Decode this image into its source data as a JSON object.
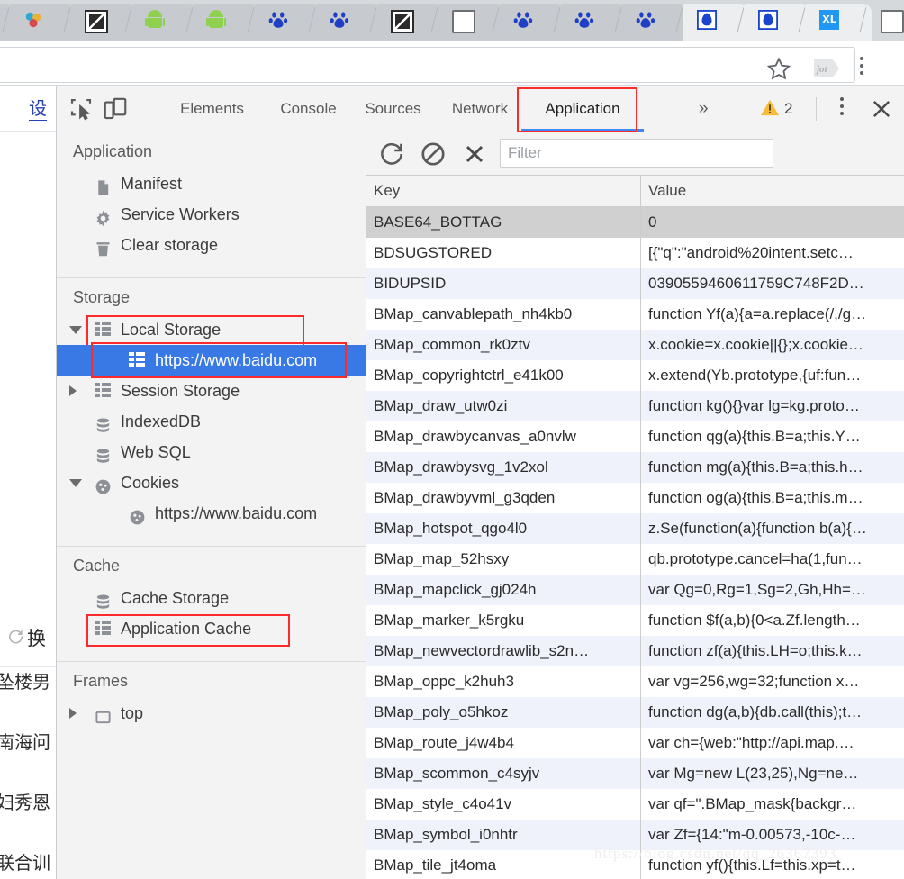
{
  "browser": {
    "tabs": [
      {
        "icon": "colored-site-icon"
      },
      {
        "icon": "colored-site-icon"
      },
      {
        "icon": "document-bw-icon"
      },
      {
        "icon": "android-icon"
      },
      {
        "icon": "android-icon"
      },
      {
        "icon": "baidu-paw-icon"
      },
      {
        "icon": "baidu-paw-icon"
      },
      {
        "icon": "document-bw-icon"
      },
      {
        "icon": "blank-page-icon"
      },
      {
        "icon": "baidu-paw-icon"
      },
      {
        "icon": "baidu-paw-icon"
      },
      {
        "icon": "baidu-paw-icon"
      },
      {
        "icon": "blue-app-icon"
      },
      {
        "icon": "blue-app-icon"
      },
      {
        "icon": "xunlei-icon"
      },
      {
        "icon": "blank-page-icon"
      }
    ],
    "tab_overflow_chevron": "^",
    "omnibox_value": "",
    "bookmark_icon": "star-icon",
    "extension_label": "jot",
    "menu_icon": "kebab-menu-icon"
  },
  "page_behind": {
    "top_link": "设",
    "refresh_label": "换",
    "items": [
      "坠楼男",
      "南海问",
      "妇秀恩",
      "联合训"
    ]
  },
  "devtools": {
    "inspect_icon": "inspect-element-icon",
    "device_icon": "device-toolbar-icon",
    "tabs": [
      {
        "label": "Elements",
        "selected": false
      },
      {
        "label": "Console",
        "selected": false
      },
      {
        "label": "Sources",
        "selected": false
      },
      {
        "label": "Network",
        "selected": false
      },
      {
        "label": "Application",
        "selected": true
      }
    ],
    "more_tabs_icon": "double-chevron-right-icon",
    "warning_icon": "warning-triangle-icon",
    "warning_count": "2",
    "menu_icon": "kebab-menu-icon",
    "close_icon": "close-icon",
    "accent_color": "#4285f4",
    "highlight_color": "#fb2b2b",
    "selection_color": "#3879e6"
  },
  "sidebar": {
    "sections": [
      {
        "title": "Application",
        "items": [
          {
            "label": "Manifest",
            "icon": "manifest-file-icon",
            "indent": 1,
            "twisty": "none",
            "selected": false,
            "highlighted": false
          },
          {
            "label": "Service Workers",
            "icon": "gear-icon",
            "indent": 1,
            "twisty": "none",
            "selected": false,
            "highlighted": false
          },
          {
            "label": "Clear storage",
            "icon": "trash-icon",
            "indent": 1,
            "twisty": "none",
            "selected": false,
            "highlighted": false
          }
        ]
      },
      {
        "title": "Storage",
        "items": [
          {
            "label": "Local Storage",
            "icon": "storage-table-icon",
            "indent": 1,
            "twisty": "open",
            "selected": false,
            "highlighted": true
          },
          {
            "label": "https://www.baidu.com",
            "icon": "storage-table-icon",
            "indent": 2,
            "twisty": "none",
            "selected": true,
            "highlighted": true
          },
          {
            "label": "Session Storage",
            "icon": "storage-table-icon",
            "indent": 1,
            "twisty": "closed",
            "selected": false,
            "highlighted": false
          },
          {
            "label": "IndexedDB",
            "icon": "database-icon",
            "indent": 1,
            "twisty": "none",
            "selected": false,
            "highlighted": false
          },
          {
            "label": "Web SQL",
            "icon": "database-icon",
            "indent": 1,
            "twisty": "none",
            "selected": false,
            "highlighted": false
          },
          {
            "label": "Cookies",
            "icon": "cookie-icon",
            "indent": 1,
            "twisty": "open",
            "selected": false,
            "highlighted": false
          },
          {
            "label": "https://www.baidu.com",
            "icon": "cookie-icon",
            "indent": 2,
            "twisty": "none",
            "selected": false,
            "highlighted": false
          }
        ]
      },
      {
        "title": "Cache",
        "items": [
          {
            "label": "Cache Storage",
            "icon": "database-icon",
            "indent": 1,
            "twisty": "none",
            "selected": false,
            "highlighted": false
          },
          {
            "label": "Application Cache",
            "icon": "storage-table-icon",
            "indent": 1,
            "twisty": "none",
            "selected": false,
            "highlighted": true
          }
        ]
      },
      {
        "title": "Frames",
        "items": [
          {
            "label": "top",
            "icon": "frame-icon",
            "indent": 1,
            "twisty": "closed",
            "selected": false,
            "highlighted": false
          }
        ]
      }
    ]
  },
  "main": {
    "toolbar": {
      "refresh_icon": "refresh-icon",
      "clear_icon": "no-entry-clear-icon",
      "delete_icon": "close-x-icon",
      "filter_placeholder": "Filter",
      "filter_value": ""
    },
    "table": {
      "columns": [
        "Key",
        "Value"
      ],
      "rows": [
        {
          "key": "BASE64_BOTTAG",
          "value": "0",
          "selected": true
        },
        {
          "key": "BDSUGSTORED",
          "value": "[{\"q\":\"android%20intent.setc…"
        },
        {
          "key": "BIDUPSID",
          "value": "0390559460611759C748F2D…"
        },
        {
          "key": "BMap_canvablepath_nh4kb0",
          "value": "function Yf(a){a=a.replace(/,/g…"
        },
        {
          "key": "BMap_common_rk0ztv",
          "value": "x.cookie=x.cookie||{};x.cookie…"
        },
        {
          "key": "BMap_copyrightctrl_e41k00",
          "value": "x.extend(Yb.prototype,{uf:fun…"
        },
        {
          "key": "BMap_draw_utw0zi",
          "value": "function kg(){}var lg=kg.proto…"
        },
        {
          "key": "BMap_drawbycanvas_a0nvlw",
          "value": "function qg(a){this.B=a;this.Y…"
        },
        {
          "key": "BMap_drawbysvg_1v2xol",
          "value": "function mg(a){this.B=a;this.h…"
        },
        {
          "key": "BMap_drawbyvml_g3qden",
          "value": "function og(a){this.B=a;this.m…"
        },
        {
          "key": "BMap_hotspot_qgo4l0",
          "value": "z.Se(function(a){function b(a){…"
        },
        {
          "key": "BMap_map_52hsxy",
          "value": "qb.prototype.cancel=ha(1,fun…"
        },
        {
          "key": "BMap_mapclick_gj024h",
          "value": "var Qg=0,Rg=1,Sg=2,Gh,Hh=…"
        },
        {
          "key": "BMap_marker_k5rgku",
          "value": "function $f(a,b){0<a.Zf.length…"
        },
        {
          "key": "BMap_newvectordrawlib_s2n…",
          "value": "function zf(a){this.LH=o;this.k…"
        },
        {
          "key": "BMap_oppc_k2huh3",
          "value": "var vg=256,wg=32;function x…"
        },
        {
          "key": "BMap_poly_o5hkoz",
          "value": "function dg(a,b){db.call(this);t…"
        },
        {
          "key": "BMap_route_j4w4b4",
          "value": "var ch={web:\"http://api.map.…"
        },
        {
          "key": "BMap_scommon_c4syjv",
          "value": "var Mg=new L(23,25),Ng=ne…"
        },
        {
          "key": "BMap_style_c4o41v",
          "value": "var qf=\".BMap_mask{backgr…"
        },
        {
          "key": "BMap_symbol_i0nhtr",
          "value": "var Zf={14:\"m-0.00573,-10c-…"
        },
        {
          "key": "BMap_tile_jt4oma",
          "value": "function yf(){this.Lf=this.xp=t…"
        }
      ]
    }
  },
  "watermark": "https://blog.csdn.net/qq_26367393"
}
